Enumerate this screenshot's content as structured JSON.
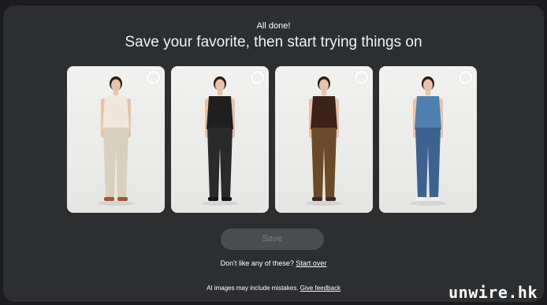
{
  "header": {
    "status": "All done!",
    "title": "Save your favorite, then start trying things on"
  },
  "outfits": [
    {
      "top": "#efe8da",
      "bottom": "#d8cfbc",
      "shoes": "#9a5a3a",
      "skin": "#e8c3a9"
    },
    {
      "top": "#1f1f1f",
      "bottom": "#2a2a2a",
      "shoes": "#151515",
      "skin": "#e8c3a9"
    },
    {
      "top": "#3c2219",
      "bottom": "#6b4a2a",
      "shoes": "#3a2a20",
      "skin": "#e8c3a9"
    },
    {
      "top": "#4f7fae",
      "bottom": "#3d6290",
      "shoes": "#eeeeee",
      "skin": "#e8c3a9"
    }
  ],
  "save_label": "Save",
  "dislike": {
    "text": "Don't like any of these?",
    "link": "Start over"
  },
  "footer": {
    "text": "AI images may include mistakes.",
    "link": "Give feedback"
  },
  "watermark": "unwire.hk"
}
